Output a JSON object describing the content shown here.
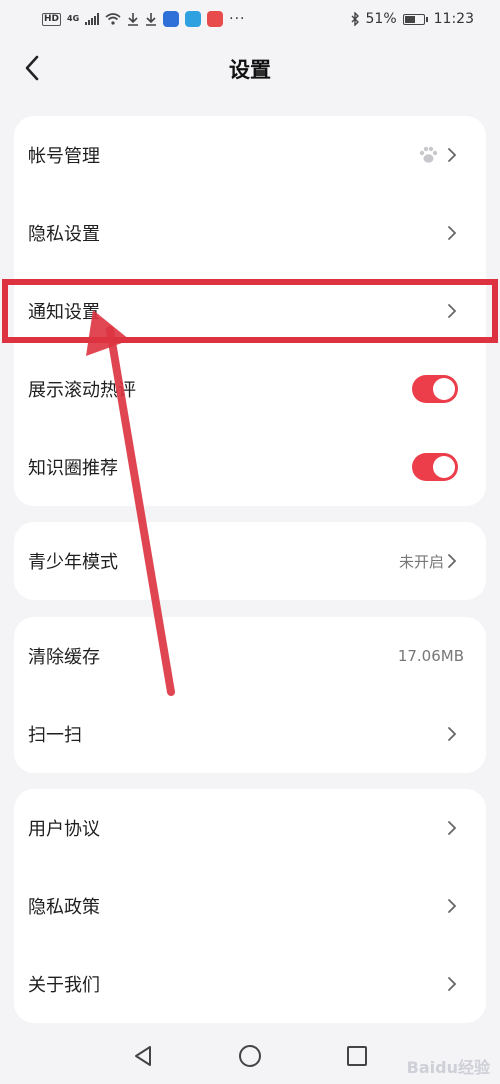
{
  "status_bar": {
    "hd": "HD",
    "net": "4G",
    "battery": "51%",
    "time": "11:23",
    "apps": [
      {
        "name": "download-icon"
      },
      {
        "name": "download-icon"
      },
      {
        "name": "app-icon",
        "color": "#2f6fd8"
      },
      {
        "name": "app-icon",
        "color": "#2fa0e0"
      },
      {
        "name": "app-icon",
        "color": "#e84b4b"
      }
    ],
    "more": "···"
  },
  "header": {
    "title": "设置"
  },
  "cards": {
    "account": [
      {
        "label": "帐号管理",
        "accessory": "paw-chevron"
      },
      {
        "label": "隐私设置",
        "accessory": "chevron"
      },
      {
        "label": "通知设置",
        "accessory": "chevron"
      },
      {
        "label": "展示滚动热评",
        "accessory": "toggle",
        "on": true
      },
      {
        "label": "知识圈推荐",
        "accessory": "toggle",
        "on": true
      }
    ],
    "youth": [
      {
        "label": "青少年模式",
        "value": "未开启",
        "accessory": "chevron"
      }
    ],
    "storage": [
      {
        "label": "清除缓存",
        "value": "17.06MB"
      },
      {
        "label": "扫一扫",
        "accessory": "chevron"
      }
    ],
    "about": [
      {
        "label": "用户协议",
        "accessory": "chevron"
      },
      {
        "label": "隐私政策",
        "accessory": "chevron"
      },
      {
        "label": "关于我们",
        "accessory": "chevron"
      }
    ]
  },
  "watermark": "Baidu经验",
  "colors": {
    "accent": "#ec3e4a",
    "annotation": "#dd3340",
    "background": "#f4f4f6"
  }
}
